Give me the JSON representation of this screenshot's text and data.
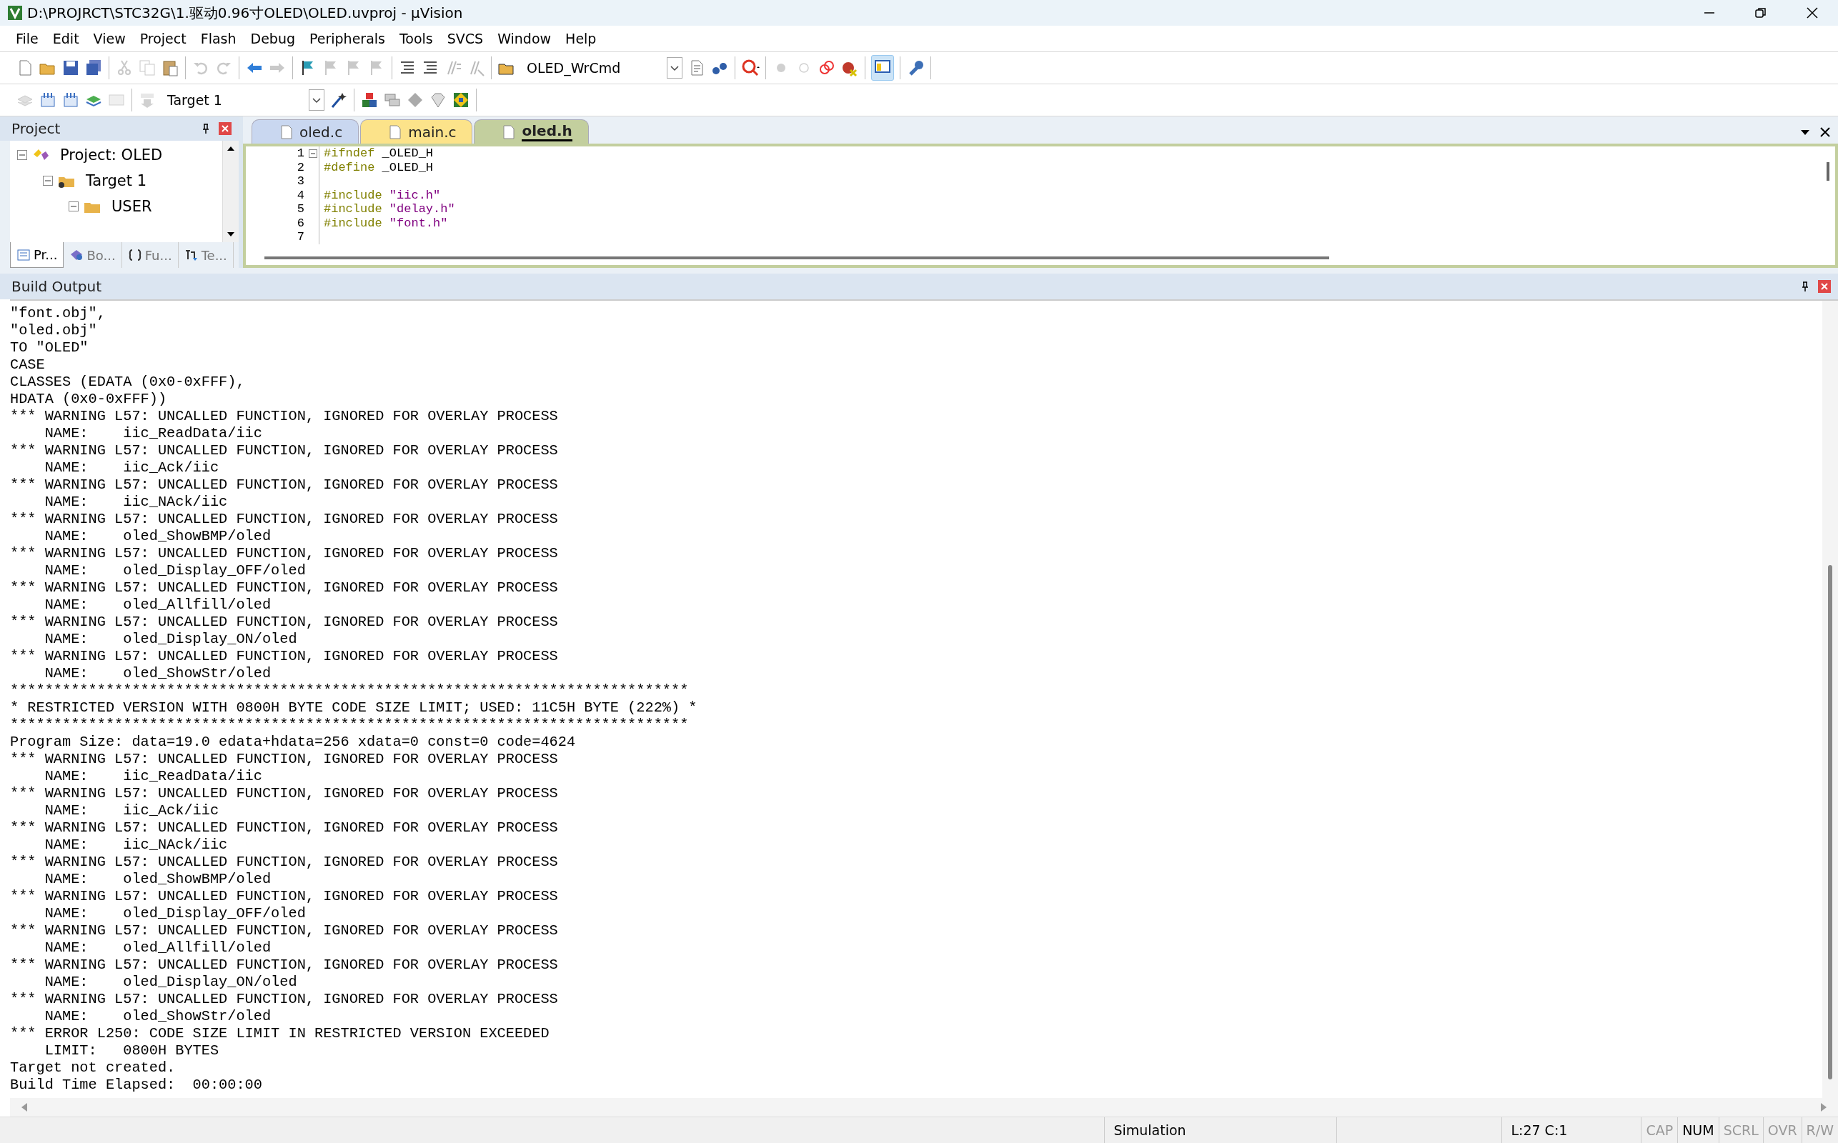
{
  "window": {
    "title": "D:\\PROJRCT\\STC32G\\1.驱动0.96寸OLED\\OLED.uvproj - µVision"
  },
  "menu": [
    "File",
    "Edit",
    "View",
    "Project",
    "Flash",
    "Debug",
    "Peripherals",
    "Tools",
    "SVCS",
    "Window",
    "Help"
  ],
  "toolbar": {
    "function_box": "OLED_WrCmd",
    "target_box": "Target 1"
  },
  "project_panel": {
    "title": "Project",
    "tree": [
      {
        "label": "Project: OLED",
        "expanded": true,
        "children": [
          {
            "label": "Target 1",
            "expanded": true,
            "children": [
              {
                "label": "USER",
                "expanded": true
              }
            ]
          }
        ]
      }
    ],
    "tabs": [
      {
        "label": "Pr...",
        "selected": true
      },
      {
        "label": "Bo...",
        "selected": false
      },
      {
        "label": "Fu...",
        "selected": false
      },
      {
        "label": "Te...",
        "selected": false
      }
    ]
  },
  "editor": {
    "tabs": [
      {
        "label": "oled.c",
        "selected": false,
        "color": "#c9d7f0"
      },
      {
        "label": "main.c",
        "selected": false,
        "color": "#fce38a"
      },
      {
        "label": "oled.h",
        "selected": true,
        "color": "#c3cf9e"
      }
    ],
    "lines": [
      {
        "number": "1",
        "fold": true,
        "code": [
          {
            "kind": "pre",
            "text": "#ifndef"
          },
          {
            "kind": "plain",
            "text": " _OLED_H"
          }
        ]
      },
      {
        "number": "2",
        "fold": false,
        "code": [
          {
            "kind": "pre",
            "text": "#define"
          },
          {
            "kind": "plain",
            "text": " _OLED_H"
          }
        ]
      },
      {
        "number": "3",
        "fold": false
      },
      {
        "number": "4",
        "fold": false,
        "code": [
          {
            "kind": "pre",
            "text": "#include"
          },
          {
            "kind": "string",
            "text": " \"iic.h\""
          }
        ]
      },
      {
        "number": "5",
        "fold": false,
        "code": [
          {
            "kind": "pre",
            "text": "#include"
          },
          {
            "kind": "string",
            "text": " \"delay.h\""
          }
        ]
      },
      {
        "number": "6",
        "fold": false,
        "code": [
          {
            "kind": "pre",
            "text": "#include"
          },
          {
            "kind": "string",
            "text": " \"font.h\""
          }
        ]
      },
      {
        "number": "7",
        "fold": false
      }
    ]
  },
  "build_output": {
    "title": "Build Output",
    "lines": [
      "\"font.obj\",",
      "\"oled.obj\"",
      "TO \"OLED\"",
      "CASE",
      "CLASSES (EDATA (0x0-0xFFF),",
      "HDATA (0x0-0xFFF))",
      "*** WARNING L57: UNCALLED FUNCTION, IGNORED FOR OVERLAY PROCESS",
      "    NAME:    iic_ReadData/iic",
      "*** WARNING L57: UNCALLED FUNCTION, IGNORED FOR OVERLAY PROCESS",
      "    NAME:    iic_Ack/iic",
      "*** WARNING L57: UNCALLED FUNCTION, IGNORED FOR OVERLAY PROCESS",
      "    NAME:    iic_NAck/iic",
      "*** WARNING L57: UNCALLED FUNCTION, IGNORED FOR OVERLAY PROCESS",
      "    NAME:    oled_ShowBMP/oled",
      "*** WARNING L57: UNCALLED FUNCTION, IGNORED FOR OVERLAY PROCESS",
      "    NAME:    oled_Display_OFF/oled",
      "*** WARNING L57: UNCALLED FUNCTION, IGNORED FOR OVERLAY PROCESS",
      "    NAME:    oled_Allfill/oled",
      "*** WARNING L57: UNCALLED FUNCTION, IGNORED FOR OVERLAY PROCESS",
      "    NAME:    oled_Display_ON/oled",
      "*** WARNING L57: UNCALLED FUNCTION, IGNORED FOR OVERLAY PROCESS",
      "    NAME:    oled_ShowStr/oled",
      "******************************************************************************",
      "* RESTRICTED VERSION WITH 0800H BYTE CODE SIZE LIMIT; USED: 11C5H BYTE (222%) *",
      "******************************************************************************",
      "Program Size: data=19.0 edata+hdata=256 xdata=0 const=0 code=4624",
      "*** WARNING L57: UNCALLED FUNCTION, IGNORED FOR OVERLAY PROCESS",
      "    NAME:    iic_ReadData/iic",
      "*** WARNING L57: UNCALLED FUNCTION, IGNORED FOR OVERLAY PROCESS",
      "    NAME:    iic_Ack/iic",
      "*** WARNING L57: UNCALLED FUNCTION, IGNORED FOR OVERLAY PROCESS",
      "    NAME:    iic_NAck/iic",
      "*** WARNING L57: UNCALLED FUNCTION, IGNORED FOR OVERLAY PROCESS",
      "    NAME:    oled_ShowBMP/oled",
      "*** WARNING L57: UNCALLED FUNCTION, IGNORED FOR OVERLAY PROCESS",
      "    NAME:    oled_Display_OFF/oled",
      "*** WARNING L57: UNCALLED FUNCTION, IGNORED FOR OVERLAY PROCESS",
      "    NAME:    oled_Allfill/oled",
      "*** WARNING L57: UNCALLED FUNCTION, IGNORED FOR OVERLAY PROCESS",
      "    NAME:    oled_Display_ON/oled",
      "*** WARNING L57: UNCALLED FUNCTION, IGNORED FOR OVERLAY PROCESS",
      "    NAME:    oled_ShowStr/oled",
      "*** ERROR L250: CODE SIZE LIMIT IN RESTRICTED VERSION EXCEEDED",
      "    LIMIT:   0800H BYTES",
      "Target not created.",
      "Build Time Elapsed:  00:00:00"
    ]
  },
  "status_bar": {
    "mode": "Simulation",
    "position": "L:27 C:1",
    "indicators": [
      {
        "label": "CAP",
        "on": false
      },
      {
        "label": "NUM",
        "on": true
      },
      {
        "label": "SCRL",
        "on": false
      },
      {
        "label": "OVR",
        "on": false
      },
      {
        "label": "R/W",
        "on": false
      }
    ]
  }
}
